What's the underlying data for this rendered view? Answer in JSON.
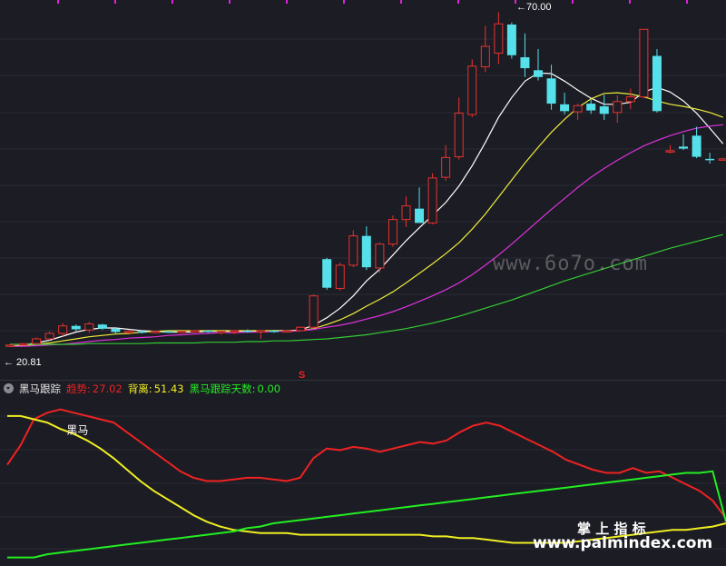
{
  "indicator": {
    "name": "黑马跟踪",
    "trend_label": "趋势:",
    "trend_value": "27.02",
    "divergence_label": "背离:",
    "divergence_value": "51.43",
    "days_label": "黑马跟踪天数:",
    "days_value": "0.00",
    "signal_label": "黑马"
  },
  "annotations": {
    "high_label": "70.00",
    "low_label": "20.81",
    "signal_marker": "S"
  },
  "watermarks": {
    "site1": "www.6o7o.com",
    "site2_title": "掌 上 指 标",
    "site2_url": "www.palmindex.com"
  },
  "colors": {
    "background": "#1c1c24",
    "up": "#e8322e",
    "down": "#55e0ea",
    "ma5": "#ffffff",
    "ma10": "#eded3c",
    "ma20": "#dd33dd",
    "ma60": "#33cc33",
    "trend": "#ee2222",
    "divergence": "#eeee22",
    "days": "#22ee22"
  },
  "chart_data": [
    {
      "type": "candlestick",
      "title": "",
      "ylim": [
        18.5,
        71
      ],
      "x": [
        1,
        2,
        3,
        4,
        5,
        6,
        7,
        8,
        9,
        10,
        11,
        12,
        13,
        14,
        15,
        16,
        17,
        18,
        19,
        20,
        21,
        22,
        23,
        24,
        25,
        26,
        27,
        28,
        29,
        30,
        31,
        32,
        33,
        34,
        35,
        36,
        37,
        38,
        39,
        40,
        41,
        42,
        43,
        44,
        45,
        46,
        47,
        48,
        49,
        50,
        51,
        52,
        53,
        54,
        55
      ],
      "ohlc": [
        [
          21.0,
          21.3,
          20.9,
          21.2
        ],
        [
          21.2,
          21.5,
          21.1,
          21.4
        ],
        [
          21.4,
          22.3,
          21.3,
          22.1
        ],
        [
          22.1,
          23.2,
          21.9,
          22.9
        ],
        [
          22.9,
          24.4,
          22.5,
          24.0
        ],
        [
          24.0,
          24.2,
          23.2,
          23.5
        ],
        [
          23.4,
          24.6,
          23.0,
          24.3
        ],
        [
          24.2,
          24.3,
          23.4,
          23.6
        ],
        [
          23.6,
          23.8,
          22.9,
          23.1
        ],
        [
          23.1,
          23.4,
          22.9,
          23.2
        ],
        [
          23.2,
          23.3,
          22.9,
          23.0
        ],
        [
          23.0,
          23.3,
          22.9,
          23.2
        ],
        [
          23.2,
          23.3,
          23.0,
          23.1
        ],
        [
          23.1,
          23.3,
          22.9,
          23.2
        ],
        [
          23.2,
          23.4,
          23.0,
          23.3
        ],
        [
          23.3,
          23.4,
          23.0,
          23.1
        ],
        [
          23.1,
          23.3,
          22.7,
          23.2
        ],
        [
          23.2,
          23.4,
          22.8,
          23.3
        ],
        [
          23.3,
          23.5,
          23.0,
          23.2
        ],
        [
          23.2,
          23.3,
          22.1,
          23.3
        ],
        [
          23.3,
          23.4,
          23.0,
          23.1
        ],
        [
          23.2,
          23.3,
          23.0,
          23.3
        ],
        [
          23.3,
          23.9,
          23.2,
          23.8
        ],
        [
          23.8,
          28.6,
          23.6,
          28.4
        ],
        [
          33.8,
          34.0,
          29.3,
          29.6
        ],
        [
          29.5,
          33.3,
          29.2,
          32.9
        ],
        [
          32.9,
          38.0,
          32.6,
          37.2
        ],
        [
          37.2,
          38.6,
          32.2,
          32.6
        ],
        [
          32.5,
          36.2,
          31.8,
          36.0
        ],
        [
          36.0,
          40.2,
          35.6,
          39.6
        ],
        [
          39.6,
          43.0,
          38.5,
          41.6
        ],
        [
          41.2,
          44.3,
          40.2,
          39.1
        ],
        [
          39.1,
          46.4,
          38.9,
          45.7
        ],
        [
          45.8,
          50.5,
          45.3,
          48.7
        ],
        [
          48.8,
          57.5,
          48.4,
          55.2
        ],
        [
          55.0,
          63.1,
          54.6,
          62.1
        ],
        [
          62.0,
          68.0,
          61.2,
          65.0
        ],
        [
          64.0,
          70.0,
          62.4,
          68.3
        ],
        [
          68.2,
          68.5,
          63.2,
          63.7
        ],
        [
          63.4,
          66.9,
          60.5,
          61.8
        ],
        [
          61.5,
          64.6,
          60.0,
          60.5
        ],
        [
          60.3,
          62.3,
          55.7,
          56.6
        ],
        [
          56.5,
          58.2,
          55.0,
          55.5
        ],
        [
          55.4,
          56.6,
          54.2,
          56.3
        ],
        [
          56.6,
          57.2,
          55.1,
          55.6
        ],
        [
          56.2,
          57.9,
          54.2,
          55.1
        ],
        [
          55.3,
          57.8,
          53.8,
          56.9
        ],
        [
          56.9,
          58.8,
          55.8,
          57.6
        ],
        [
          57.6,
          67.5,
          57.4,
          67.5
        ],
        [
          63.6,
          64.6,
          55.3,
          55.5
        ],
        [
          49.6,
          50.5,
          49.3,
          49.7
        ],
        [
          50.3,
          52.1,
          49.8,
          50.0
        ],
        [
          51.9,
          53.2,
          48.6,
          48.8
        ],
        [
          48.5,
          49.4,
          47.8,
          48.4
        ],
        [
          48.5,
          48.6,
          48.3,
          48.5
        ]
      ],
      "series": [
        {
          "name": "MA5",
          "values": [
            21.0,
            21.2,
            21.5,
            21.9,
            22.5,
            23.1,
            23.5,
            23.7,
            23.7,
            23.5,
            23.3,
            23.2,
            23.1,
            23.1,
            23.1,
            23.2,
            23.2,
            23.2,
            23.2,
            23.2,
            23.3,
            23.3,
            23.4,
            24.1,
            25.2,
            26.6,
            28.4,
            30.6,
            32.3,
            34.4,
            36.5,
            38.4,
            40.2,
            42.1,
            44.5,
            47.5,
            50.9,
            54.6,
            57.5,
            59.9,
            61.1,
            61.0,
            59.9,
            58.6,
            57.4,
            56.5,
            56.5,
            56.8,
            58.3,
            59.0,
            58.3,
            57.0,
            55.2,
            53.0,
            50.7
          ]
        },
        {
          "name": "MA10",
          "values": [
            21.0,
            21.1,
            21.3,
            21.5,
            21.8,
            22.1,
            22.4,
            22.6,
            22.8,
            22.9,
            23.1,
            23.2,
            23.3,
            23.3,
            23.3,
            23.3,
            23.3,
            23.3,
            23.3,
            23.3,
            23.3,
            23.3,
            23.3,
            23.6,
            24.2,
            24.9,
            25.8,
            26.9,
            27.9,
            29.0,
            30.3,
            31.7,
            33.1,
            34.6,
            36.2,
            38.2,
            40.4,
            42.9,
            45.4,
            47.9,
            50.2,
            52.4,
            54.3,
            56.0,
            57.3,
            58.1,
            58.2,
            58.0,
            57.6,
            57.0,
            56.5,
            56.2,
            55.8,
            55.3,
            54.6
          ]
        },
        {
          "name": "MA20",
          "values": [
            21.0,
            21.0,
            21.1,
            21.2,
            21.3,
            21.5,
            21.7,
            21.9,
            22.0,
            22.2,
            22.3,
            22.4,
            22.6,
            22.7,
            22.8,
            22.9,
            23.0,
            23.0,
            23.1,
            23.1,
            23.2,
            23.2,
            23.3,
            23.5,
            23.8,
            24.1,
            24.5,
            25.0,
            25.5,
            26.1,
            26.8,
            27.6,
            28.4,
            29.3,
            30.3,
            31.5,
            32.9,
            34.4,
            36.0,
            37.7,
            39.4,
            41.1,
            42.7,
            44.3,
            45.8,
            47.1,
            48.3,
            49.4,
            50.4,
            51.2,
            51.9,
            52.5,
            53.0,
            53.3,
            53.5
          ]
        },
        {
          "name": "MA60",
          "values": [
            21.3,
            21.3,
            21.3,
            21.3,
            21.3,
            21.3,
            21.4,
            21.4,
            21.4,
            21.4,
            21.4,
            21.5,
            21.5,
            21.5,
            21.5,
            21.6,
            21.6,
            21.6,
            21.7,
            21.7,
            21.8,
            21.8,
            21.9,
            22.0,
            22.1,
            22.3,
            22.5,
            22.7,
            23.0,
            23.3,
            23.6,
            24.0,
            24.4,
            24.9,
            25.4,
            26.0,
            26.6,
            27.2,
            27.8,
            28.5,
            29.2,
            29.9,
            30.6,
            31.2,
            31.8,
            32.4,
            33.0,
            33.6,
            34.2,
            34.8,
            35.4,
            35.9,
            36.4,
            36.9,
            37.4
          ]
        }
      ]
    },
    {
      "type": "line",
      "title": "",
      "ylim": [
        0,
        100
      ],
      "x": [
        1,
        2,
        3,
        4,
        5,
        6,
        7,
        8,
        9,
        10,
        11,
        12,
        13,
        14,
        15,
        16,
        17,
        18,
        19,
        20,
        21,
        22,
        23,
        24,
        25,
        26,
        27,
        28,
        29,
        30,
        31,
        32,
        33,
        34,
        35,
        36,
        37,
        38,
        39,
        40,
        41,
        42,
        43,
        44,
        45,
        46,
        47,
        48,
        49,
        50,
        51,
        52,
        53,
        54,
        55
      ],
      "series": [
        {
          "name": "趋势",
          "values": [
            60,
            72,
            88,
            92,
            94,
            92,
            90,
            88,
            86,
            80,
            74,
            68,
            62,
            56,
            52,
            50,
            50,
            51,
            52,
            52,
            51,
            50,
            52,
            64,
            70,
            69,
            71,
            70,
            68,
            70,
            72,
            74,
            73,
            75,
            80,
            84,
            86,
            84,
            80,
            76,
            72,
            68,
            63,
            60,
            57,
            55,
            55,
            58,
            55,
            56,
            52,
            48,
            44,
            38,
            27
          ]
        },
        {
          "name": "背离",
          "values": [
            90,
            90,
            88,
            86,
            82,
            79,
            75,
            70,
            64,
            57,
            50,
            44,
            39,
            34,
            29,
            25,
            22,
            20,
            19,
            18,
            18,
            18,
            17,
            17,
            17,
            17,
            17,
            17,
            17,
            17,
            17,
            17,
            16,
            16,
            15,
            15,
            14,
            13,
            12,
            12,
            12,
            12,
            12,
            13,
            14,
            15,
            16,
            17,
            18,
            19,
            20,
            20,
            21,
            22,
            24
          ]
        },
        {
          "name": "黑马跟踪天数",
          "values": [
            3,
            3,
            3,
            5,
            6,
            7,
            8,
            9,
            10,
            11,
            12,
            13,
            14,
            15,
            16,
            17,
            18,
            19,
            21,
            22,
            24,
            25,
            26,
            27,
            28,
            29,
            30,
            31,
            32,
            33,
            34,
            35,
            36,
            37,
            38,
            39,
            40,
            41,
            42,
            43,
            44,
            45,
            46,
            47,
            48,
            49,
            50,
            51,
            52,
            53,
            54,
            55,
            55,
            56,
            25
          ]
        }
      ],
      "markers": [
        {
          "x": 3,
          "label": "黑马"
        }
      ]
    }
  ]
}
